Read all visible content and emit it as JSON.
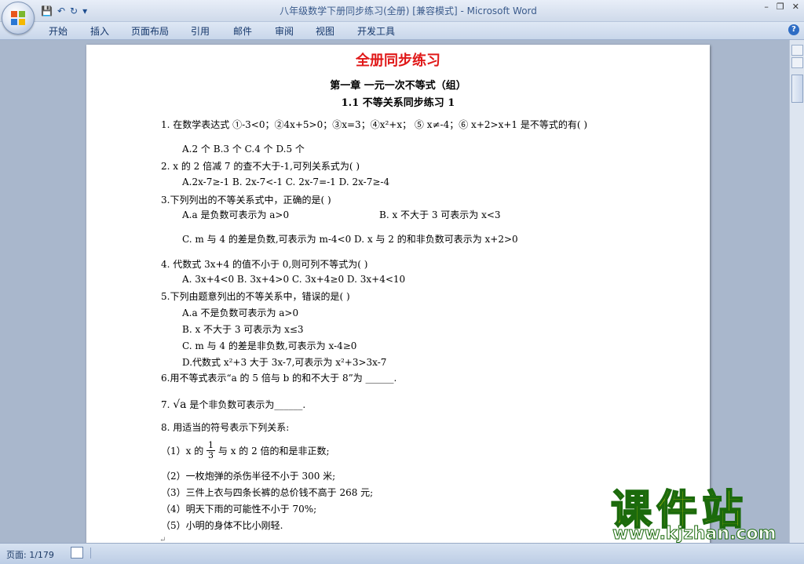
{
  "window": {
    "title": "八年级数学下册同步练习(全册) [兼容模式] - Microsoft Word",
    "controls": {
      "minimize": "–",
      "restore": "❐",
      "close": "✕"
    }
  },
  "ribbon": {
    "tabs": [
      "开始",
      "插入",
      "页面布局",
      "引用",
      "邮件",
      "审阅",
      "视图",
      "开发工具"
    ],
    "help": "?"
  },
  "quick_access": {
    "save_icon": "💾",
    "undo_icon": "↶",
    "redo_icon": "↻",
    "more_icon": "▾"
  },
  "status": {
    "page": "页面: 1/179"
  },
  "doc": {
    "title": "全册同步练习",
    "chapter": "第一章  一元一次不等式（组）",
    "section": "1.1 不等关系同步练习 1",
    "q1": "1.  在数学表达式  ①-3<0；②4x+5>0；③x=3；④x²+x；  ⑤ x≠-4；⑥ x+2>x+1 是不等式的有(   )",
    "q1_opts": "A.2 个      B.3 个      C.4 个      D.5 个",
    "q2": "2. x 的 2 倍减 7 的查不大于-1,可列关系式为(    )",
    "q2_opts": "A.2x-7≥-1     B. 2x-7<-1     C. 2x-7=-1      D. 2x-7≥-4",
    "q3": "3.下列列出的不等关系式中，正确的是(    )",
    "q3_a": "A.a 是负数可表示为 a>0",
    "q3_b": "B. x 不大于 3 可表示为 x<3",
    "q3_c": "C. m 与 4 的差是负数,可表示为 m-4<0     D. x 与 2 的和非负数可表示为 x+2>0",
    "q4": "4. 代数式 3x+4 的值不小于 0,则可列不等式为(    )",
    "q4_opts": "A.  3x+4<0     B.  3x+4>0    C.  3x+4≥0      D.  3x+4<10",
    "q5": "5.下列由题意列出的不等关系中，错误的是(    )",
    "q5_a": "A.a 不是负数可表示为 a>0",
    "q5_b": "B. x 不大于 3 可表示为 x≤3",
    "q5_c": "C. m 与 4 的差是非负数,可表示为 x-4≥0",
    "q5_d": "D.代数式 x²+3 大于 3x-7,可表示为 x²+3>3x-7",
    "q6": "6.用不等式表示“a 的 5 倍与 b 的和不大于 8”为 ______.",
    "q7_rad": "√a",
    "q7": " 是个非负数可表示为______.",
    "q8": "8. 用适当的符号表示下列关系:",
    "q8_1_a": "（1）x 的",
    "q8_1_num": "1",
    "q8_1_den": "3",
    "q8_1_b": "与 x 的 2 倍的和是非正数;",
    "q8_2": "（2）一枚炮弹的杀伤半径不小于 300 米;",
    "q8_3": "（3）三件上衣与四条长裤的总价钱不高于 268 元;",
    "q8_4": "（4）明天下雨的可能性不小于 70%;",
    "q8_5": "（5）小明的身体不比小刚轻.",
    "pilcrow": "↵"
  },
  "watermark": {
    "text": "课件站",
    "url": "www.kjzhan.com"
  }
}
